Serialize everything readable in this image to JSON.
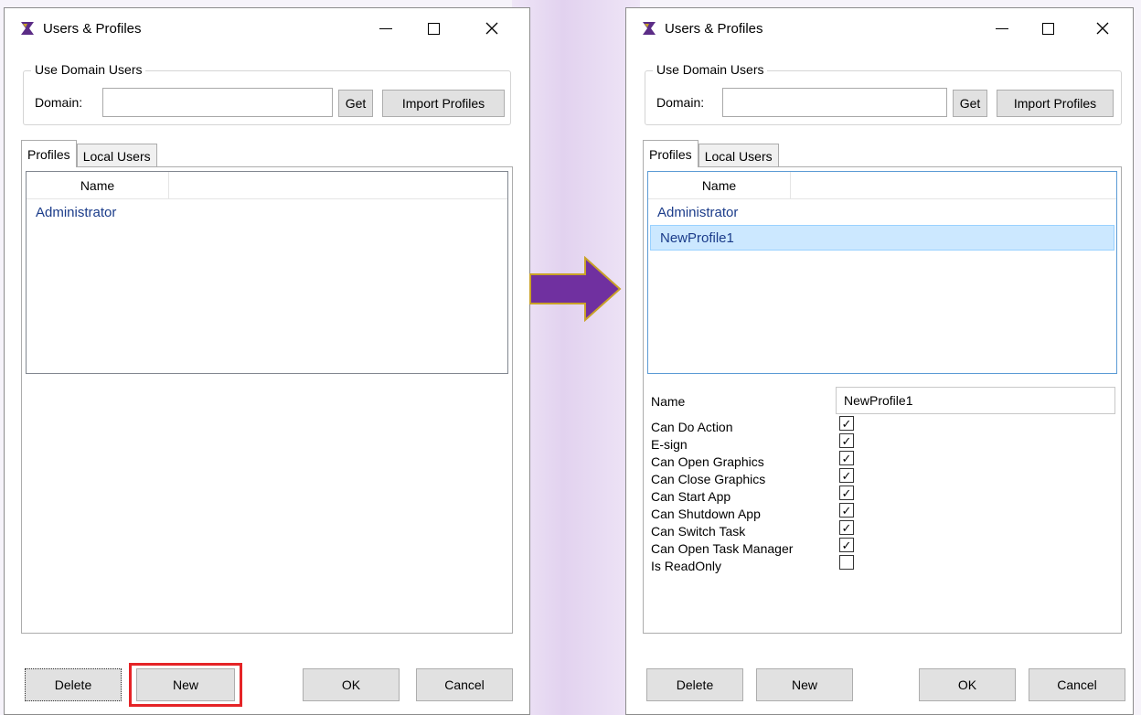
{
  "left_window": {
    "title": "Users & Profiles",
    "group_title": "Use Domain Users",
    "domain_label": "Domain:",
    "domain_value": "",
    "get_button": "Get",
    "import_button": "Import Profiles",
    "tabs": [
      "Profiles",
      "Local Users"
    ],
    "list_header": "Name",
    "profiles": [
      "Administrator"
    ],
    "buttons": {
      "delete": "Delete",
      "new": "New",
      "ok": "OK",
      "cancel": "Cancel"
    }
  },
  "right_window": {
    "title": "Users & Profiles",
    "group_title": "Use Domain Users",
    "domain_label": "Domain:",
    "domain_value": "",
    "get_button": "Get",
    "import_button": "Import Profiles",
    "tabs": [
      "Profiles",
      "Local Users"
    ],
    "list_header": "Name",
    "profiles": [
      "Administrator",
      "NewProfile1"
    ],
    "selected_profile": "NewProfile1",
    "name_label": "Name",
    "name_value": "NewProfile1",
    "permissions": [
      {
        "label": "Can Do Action",
        "checked": true
      },
      {
        "label": "E-sign",
        "checked": true
      },
      {
        "label": "Can Open Graphics",
        "checked": true
      },
      {
        "label": "Can Close Graphics",
        "checked": true
      },
      {
        "label": "Can Start App",
        "checked": true
      },
      {
        "label": "Can Shutdown App",
        "checked": true
      },
      {
        "label": "Can Switch Task",
        "checked": true
      },
      {
        "label": "Can Open Task Manager",
        "checked": true
      },
      {
        "label": "Is ReadOnly",
        "checked": false
      }
    ],
    "buttons": {
      "delete": "Delete",
      "new": "New",
      "ok": "OK",
      "cancel": "Cancel"
    }
  },
  "colors": {
    "highlight": "#e52427",
    "arrow": "#7030a0",
    "arrow_border": "#c9a227",
    "selection": "#cce8ff"
  }
}
